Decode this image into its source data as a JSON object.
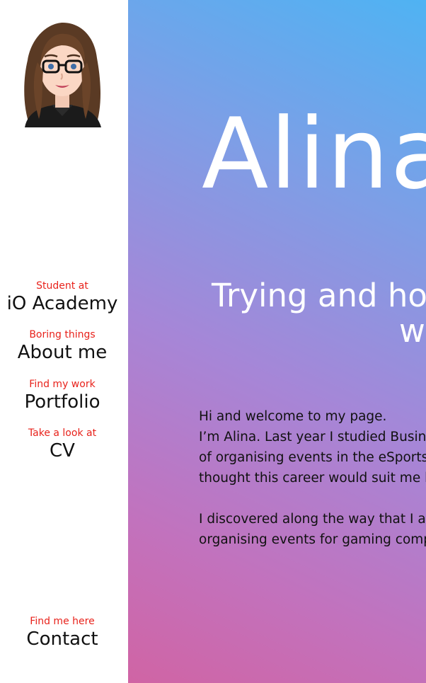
{
  "sidebar": {
    "avatar_alt": "Alina avatar",
    "nav": [
      {
        "sub": "Student at",
        "main": "iO Academy"
      },
      {
        "sub": "Boring things",
        "main": "About me"
      },
      {
        "sub": "Find my work",
        "main": "Portfolio"
      },
      {
        "sub": "Take a look at",
        "main": "CV"
      }
    ],
    "contact": {
      "sub": "Find me here",
      "main": "Contact"
    }
  },
  "hero": {
    "name": "Alina",
    "tagline_line1": "Trying and hop",
    "tagline_line2": "w",
    "intro": {
      "line1": "Hi and welcome to my page.",
      "line2": "I’m Alina. Last year I studied Busine",
      "line3": "of organising events in the eSports",
      "line4": "thought this career would suit me b",
      "line5": "I discovered along the way that I ar",
      "line6": "organising events for gaming comp"
    }
  },
  "colors": {
    "accent_red": "#e8221b",
    "gradient_top": "#4fb3f3",
    "gradient_mid": "#a686d7",
    "gradient_bottom": "#d064a4"
  }
}
